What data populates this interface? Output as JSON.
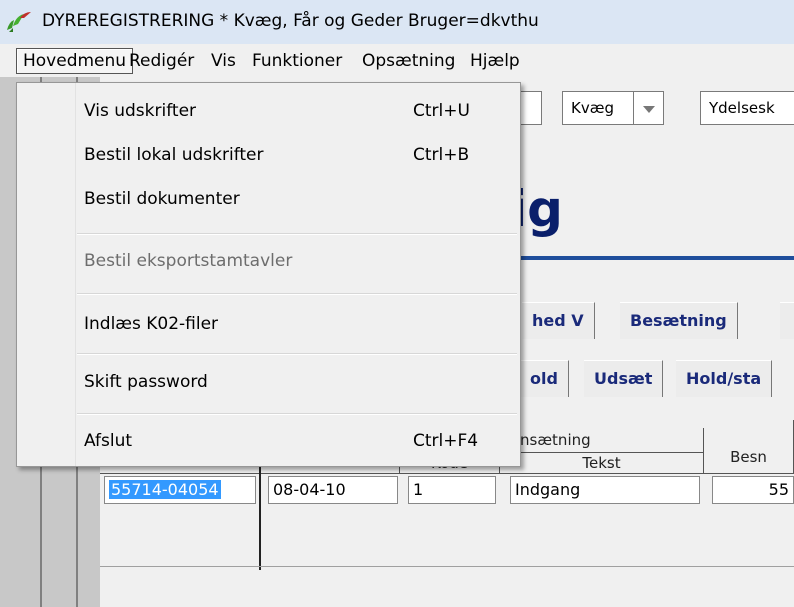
{
  "window": {
    "title": "DYREREGISTRERING * Kvæg, Får og Geder    Bruger=dkvthu"
  },
  "menubar": {
    "items": [
      {
        "label": "Hovedmenu",
        "active": true
      },
      {
        "label": "Redigér",
        "active": false
      },
      {
        "label": "Vis",
        "active": false
      },
      {
        "label": "Funktioner",
        "active": false
      },
      {
        "label": "Opsætning",
        "active": false
      },
      {
        "label": "Hjælp",
        "active": false
      }
    ]
  },
  "dropdown": {
    "items": [
      {
        "label": "Vis udskrifter",
        "shortcut": "Ctrl+U",
        "enabled": true
      },
      {
        "label": "Bestil lokal udskrifter",
        "shortcut": "Ctrl+B",
        "enabled": true
      },
      {
        "label": "Bestil dokumenter",
        "shortcut": "",
        "enabled": true
      },
      {
        "label": "Bestil eksportstamtavler",
        "shortcut": "",
        "enabled": false
      },
      {
        "label": "Indlæs K02-filer",
        "shortcut": "",
        "enabled": true
      },
      {
        "label": "Skift password",
        "shortcut": "",
        "enabled": true
      },
      {
        "label": "Afslut",
        "shortcut": "Ctrl+F4",
        "enabled": true
      }
    ]
  },
  "background": {
    "species_select": "Kvæg",
    "ydelse_field": "Ydelsesk",
    "big_title_fragment": "ig",
    "tabs_row1": [
      "hed V",
      "Besætning"
    ],
    "tabs_row2": [
      "old",
      "Udsæt",
      "Hold/sta"
    ],
    "table": {
      "group_header": "nsætning",
      "col_kode": "Kode",
      "col_tekst": "Tekst",
      "col_besn": "Besn",
      "row": {
        "id": "55714-04054",
        "date": "08-04-10",
        "kode": "1",
        "tekst": "Indgang",
        "besn": "55"
      }
    }
  },
  "colors": {
    "titlebar": "#dbe6f4",
    "menu_bg": "#f0f0f0",
    "title_blue": "#0a1f6b",
    "selection": "#3399ff"
  }
}
